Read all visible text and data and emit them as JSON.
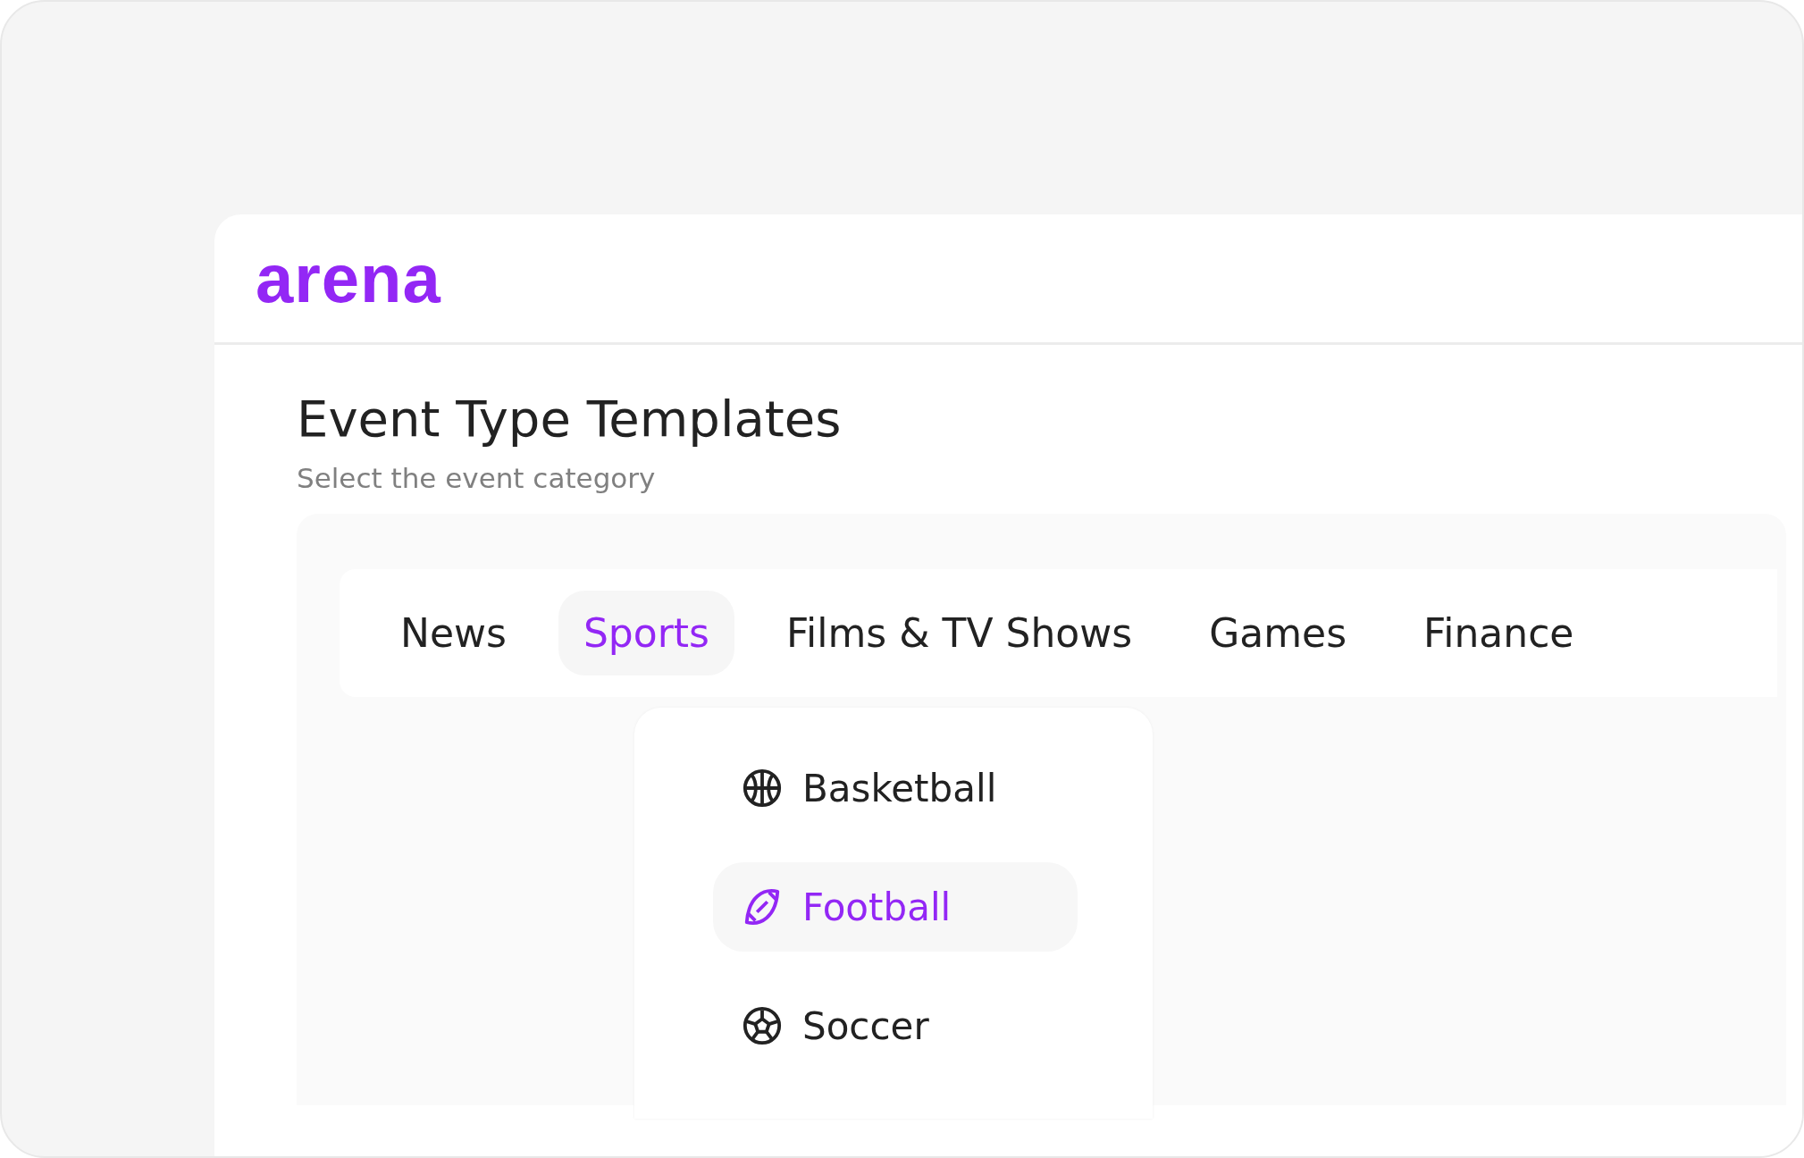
{
  "logo": "arena",
  "page": {
    "title": "Event Type Templates",
    "subtitle": "Select the event category"
  },
  "tabs": [
    {
      "label": "News",
      "selected": false
    },
    {
      "label": "Sports",
      "selected": true
    },
    {
      "label": "Films & TV Shows",
      "selected": false
    },
    {
      "label": "Games",
      "selected": false
    },
    {
      "label": "Finance",
      "selected": false
    }
  ],
  "dropdown": {
    "items": [
      {
        "label": "Basketball",
        "kind": "basketball",
        "selected": false
      },
      {
        "label": "Football",
        "kind": "football",
        "selected": true
      },
      {
        "label": "Soccer",
        "kind": "soccer",
        "selected": false
      }
    ]
  }
}
